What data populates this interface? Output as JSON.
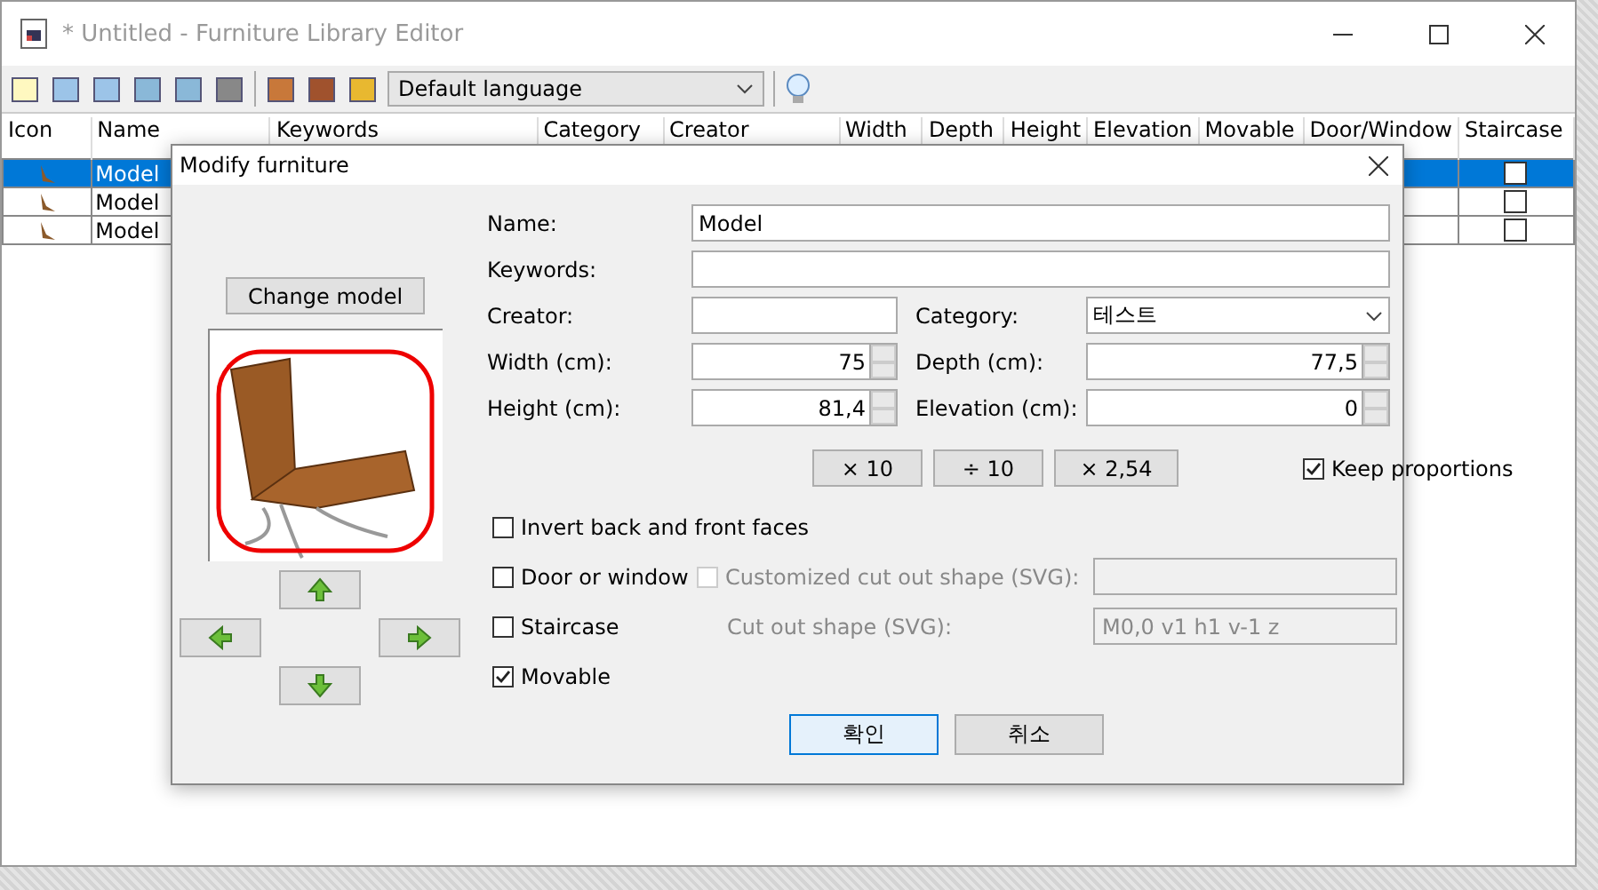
{
  "window": {
    "title": "* Untitled - Furniture Library Editor"
  },
  "toolbar": {
    "language": "Default language"
  },
  "table": {
    "columns": [
      "Icon",
      "Name",
      "Keywords",
      "Category",
      "Creator",
      "Width",
      "Depth",
      "Height",
      "Elevation",
      "Movable",
      "Door/Window",
      "Staircase"
    ],
    "rows": [
      {
        "name": "Model",
        "selected": true,
        "staircase": false
      },
      {
        "name": "Model",
        "selected": false,
        "staircase": false
      },
      {
        "name": "Model",
        "selected": false,
        "staircase": false
      }
    ]
  },
  "dialog": {
    "title": "Modify furniture",
    "change_model": "Change model",
    "name": {
      "label": "Name:",
      "value": "Model"
    },
    "keywords": {
      "label": "Keywords:"
    },
    "creator": {
      "label": "Creator:"
    },
    "category": {
      "label": "Category:",
      "value": "테스트"
    },
    "width": {
      "label": "Width (cm):",
      "value": "75"
    },
    "depth": {
      "label": "Depth (cm):",
      "value": "77,5"
    },
    "height": {
      "label": "Height (cm):",
      "value": "81,4"
    },
    "elevation": {
      "label": "Elevation (cm):",
      "value": "0"
    },
    "scale_buttons": [
      "× 10",
      "÷ 10",
      "× 2,54"
    ],
    "keep_proportions": {
      "label": "Keep proportions",
      "checked": true
    },
    "invert_faces": {
      "label": "Invert back and front faces",
      "checked": false
    },
    "door_or_window": {
      "label": "Door or window",
      "checked": false
    },
    "customized_cut_out": {
      "label": "Customized cut out shape (SVG):",
      "checked": false,
      "disabled": true
    },
    "staircase": {
      "label": "Staircase",
      "checked": false
    },
    "cut_out_shape": {
      "label": "Cut out shape (SVG):",
      "value": "M0,0 v1 h1 v-1 z",
      "disabled": true
    },
    "movable": {
      "label": "Movable",
      "checked": true
    },
    "buttons": [
      {
        "label": "확인",
        "default": true
      },
      {
        "label": "취소",
        "default": false
      }
    ]
  }
}
